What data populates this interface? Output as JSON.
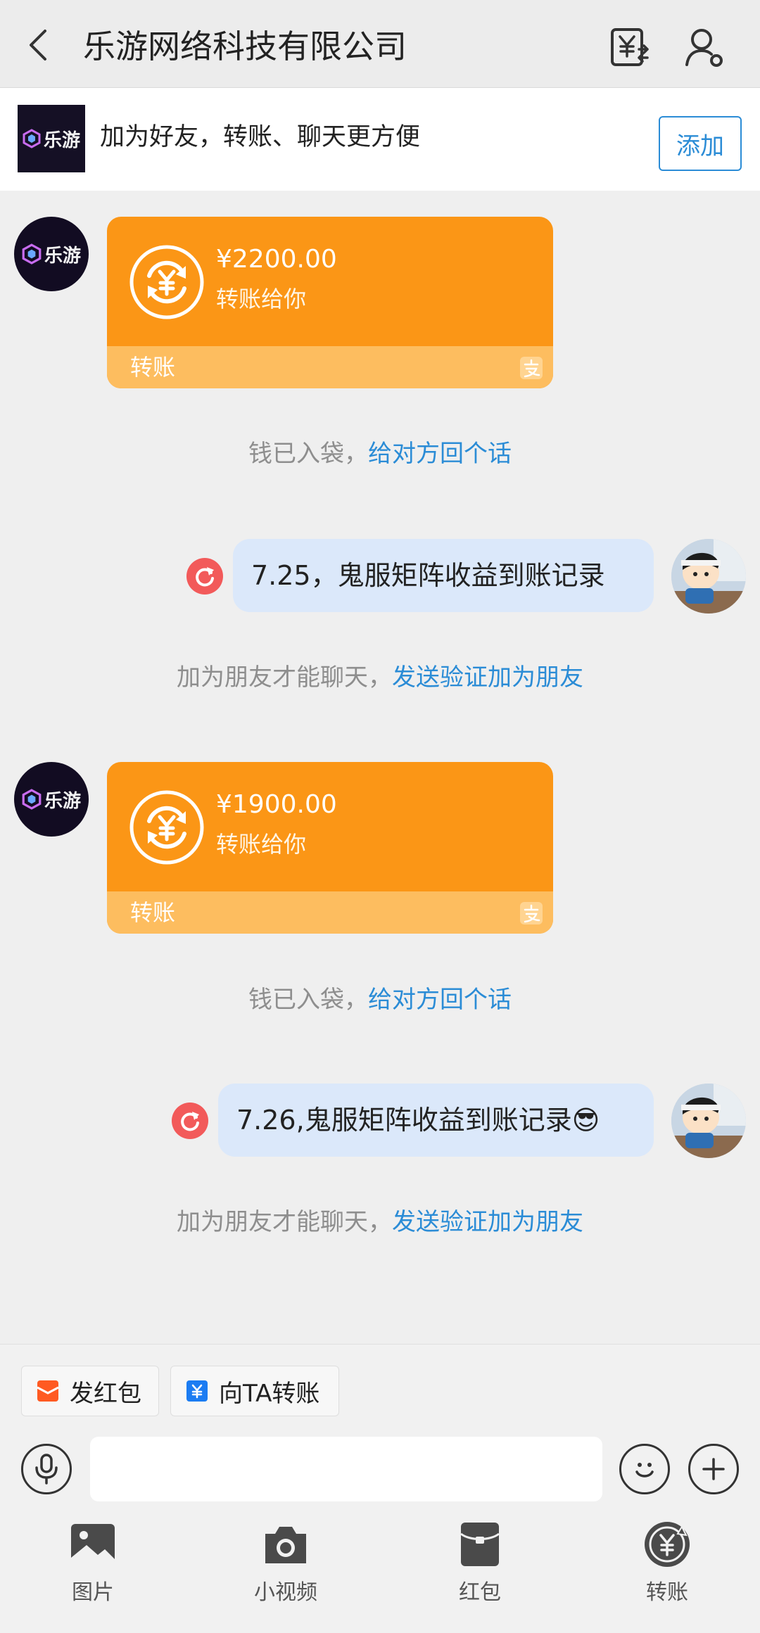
{
  "header": {
    "title": "乐游网络科技有限公司",
    "back_icon": "back-arrow-icon",
    "bill_icon": "yuan-bill-icon",
    "profile_icon": "profile-icon"
  },
  "add_banner": {
    "logo_text": "乐游",
    "text": "加为好友，转账、聊天更方便",
    "button_label": "添加"
  },
  "messages": [
    {
      "type": "transfer",
      "from": "company",
      "avatar_text": "乐游",
      "amount": "¥2200.00",
      "desc": "转账给你",
      "footer_label": "转账"
    },
    {
      "type": "system",
      "text": "钱已入袋，",
      "link": "给对方回个话"
    },
    {
      "type": "sent",
      "text": "7.25，鬼服矩阵收益到账记录",
      "status_icon": "retry-icon"
    },
    {
      "type": "system",
      "text": "加为朋友才能聊天，",
      "link": "发送验证加为朋友"
    },
    {
      "type": "transfer",
      "from": "company",
      "avatar_text": "乐游",
      "amount": "¥1900.00",
      "desc": "转账给你",
      "footer_label": "转账"
    },
    {
      "type": "system",
      "text": "钱已入袋，",
      "link": "给对方回个话"
    },
    {
      "type": "sent",
      "text": "7.26,鬼服矩阵收益到账记录😎",
      "status_icon": "retry-icon"
    },
    {
      "type": "system",
      "text": "加为朋友才能聊天，",
      "link": "发送验证加为朋友"
    }
  ],
  "quick_actions": [
    {
      "label": "发红包",
      "icon": "red-packet-icon"
    },
    {
      "label": "向TA转账",
      "icon": "transfer-icon"
    }
  ],
  "input": {
    "placeholder": ""
  },
  "tools": [
    {
      "label": "图片",
      "icon": "image-icon"
    },
    {
      "label": "小视频",
      "icon": "camera-icon"
    },
    {
      "label": "红包",
      "icon": "red-packet-icon"
    },
    {
      "label": "转账",
      "icon": "transfer-icon"
    }
  ],
  "colors": {
    "transfer_card": "#fb9616",
    "transfer_footer": "#fdbd5f",
    "link": "#2b8cd6",
    "sent_bubble": "#dbe8fa",
    "retry": "#f25a5a"
  }
}
